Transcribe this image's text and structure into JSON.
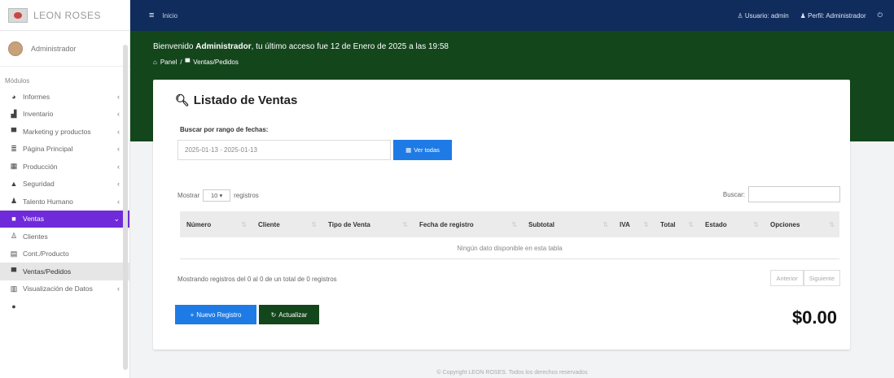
{
  "sidebar": {
    "brand": "LEON ROSES",
    "user": "Administrador",
    "section_label": "Módulos",
    "items": [
      {
        "label": "Informes",
        "icon": "chart-icon",
        "glyph": "◕",
        "chevron": "‹",
        "state": ""
      },
      {
        "label": "Inventario",
        "icon": "boxes-icon",
        "glyph": "▟",
        "chevron": "‹",
        "state": ""
      },
      {
        "label": "Marketing y productos",
        "icon": "cart-icon",
        "glyph": "▀",
        "chevron": "‹",
        "state": ""
      },
      {
        "label": "Página Principal",
        "icon": "sliders-icon",
        "glyph": "≣",
        "chevron": "‹",
        "state": ""
      },
      {
        "label": "Producción",
        "icon": "calendar-icon",
        "glyph": "▦",
        "chevron": "‹",
        "state": ""
      },
      {
        "label": "Seguridad",
        "icon": "lock-icon",
        "glyph": "▲",
        "chevron": "‹",
        "state": ""
      },
      {
        "label": "Talento Humano",
        "icon": "users-icon",
        "glyph": "♟",
        "chevron": "‹",
        "state": ""
      },
      {
        "label": "Ventas",
        "icon": "folder-icon",
        "glyph": "■",
        "chevron": "⌄",
        "state": "active"
      },
      {
        "label": "Clientes",
        "icon": "user-plus-icon",
        "glyph": "♙",
        "chevron": "",
        "state": ""
      },
      {
        "label": "Cont./Producto",
        "icon": "list-icon",
        "glyph": "▤",
        "chevron": "",
        "state": ""
      },
      {
        "label": "Ventas/Pedidos",
        "icon": "cart-icon",
        "glyph": "▀",
        "chevron": "",
        "state": "selected"
      },
      {
        "label": "Visualización de Datos",
        "icon": "bar-chart-icon",
        "glyph": "▥",
        "chevron": "‹",
        "state": ""
      },
      {
        "label": "",
        "icon": "",
        "glyph": "●",
        "chevron": "",
        "state": ""
      }
    ]
  },
  "topbar": {
    "home_link": "Inicio",
    "user_link": "Usuario: admin",
    "profile_link": "Perfil: Administrador"
  },
  "header": {
    "welcome_prefix": "Bienvenido ",
    "welcome_name": "Administrador",
    "welcome_suffix": ", tu último acceso fue 12 de Enero de 2025 a las 19:58",
    "crumb_home": "Panel",
    "crumb_sep": "/",
    "crumb_current": "Ventas/Pedidos"
  },
  "card": {
    "title": "Listado de Ventas",
    "range_label": "Buscar por rango de fechas:",
    "date_range_value": "2025-01-13 - 2025-01-13",
    "btn_ver_todas": "Ver todas",
    "show_label": "Mostrar",
    "show_value": "10",
    "records_label": "registros",
    "search_label": "Buscar:",
    "columns": [
      "Número",
      "Cliente",
      "Tipo de Venta",
      "Fecha de registro",
      "Subtotal",
      "IVA",
      "Total",
      "Estado",
      "Opciones"
    ],
    "empty_message": "Ningún dato disponible en esta tabla",
    "info": "Mostrando registros del 0 al 0 de un total de 0 registros",
    "prev": "Anterior",
    "next": "Siguiente",
    "btn_nuevo": "Nuevo Registro",
    "btn_actualizar": "Actualizar",
    "total": "$0.00"
  },
  "footer": {
    "text": "© Copyright LEON ROSES. Todos los derechos reservados"
  },
  "colors": {
    "navbar": "#0f2c5c",
    "header": "#14461c",
    "active_menu": "#6f2bd9",
    "primary_button": "#1e7be6"
  }
}
